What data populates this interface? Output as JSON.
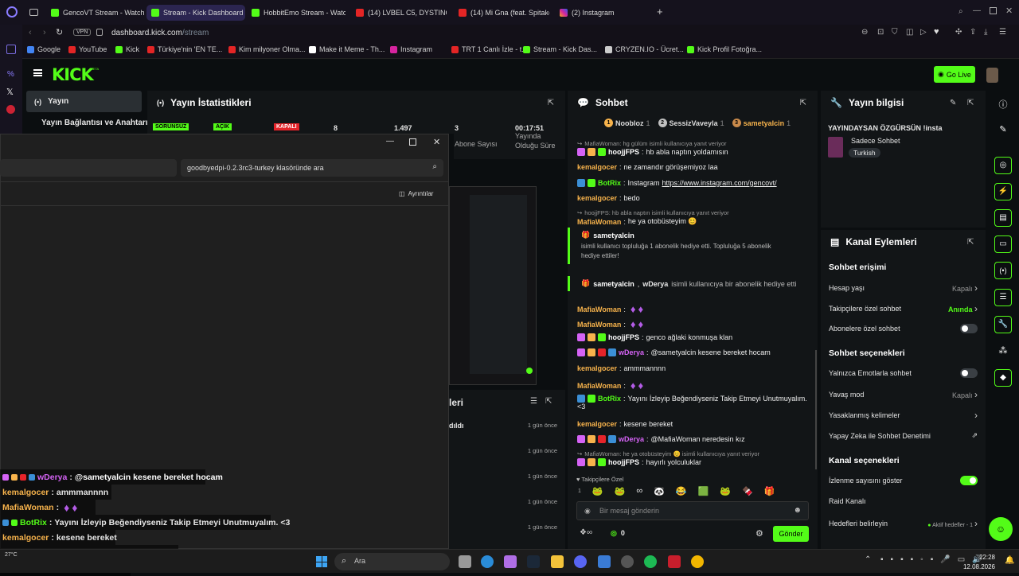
{
  "browser": {
    "tabs": [
      {
        "label": "GencoVT Stream - Watch L",
        "fav": "k"
      },
      {
        "label": "Stream - Kick Dashboard",
        "fav": "k",
        "active": true
      },
      {
        "label": "HobbitEmo Stream - Watc",
        "fav": "k"
      },
      {
        "label": "(14) LVBEL C5, DYSTINCT",
        "fav": "y"
      },
      {
        "label": "(14) Mi Gna (feat. Spitakci",
        "fav": "y"
      },
      {
        "label": "(2) Instagram",
        "fav": "i"
      }
    ],
    "new_tab": "+",
    "vpn": "VPN",
    "url_domain": "dashboard.kick.com",
    "url_path": "/stream",
    "bookmarks": [
      "Google",
      "YouTube",
      "Kick",
      "Türkiye'nin 'EN TE...",
      "Kim milyoner Olma...",
      "Make it Meme - Th...",
      "Instagram",
      "TRT 1 Canlı İzle - t...",
      "Stream - Kick Das...",
      "CRYZEN.IO - Ücret...",
      "Kick Profil Fotoğra..."
    ]
  },
  "kick": {
    "logo": "KICK",
    "beta": "BETA",
    "go_live": "Go Live",
    "nav": {
      "stream": "Yayın",
      "connection": "Yayın Bağlantısı ve Anahtarı"
    },
    "stats": {
      "title": "Yayın İstatistikleri",
      "badges": [
        "SORUNSUZ",
        "AÇIK",
        "KAPALI"
      ],
      "viewers": "8",
      "followers": "1.497",
      "subs": "3",
      "subs_label": "Abone Sayısı",
      "duration": "00:17:51",
      "duration_label": "Yayında Olduğu Süre"
    },
    "chat": {
      "title": "Sohbet",
      "top": [
        {
          "rank": "1",
          "name": "Noobloz",
          "n": "1"
        },
        {
          "rank": "2",
          "name": "SessizVaveyla",
          "n": "1"
        },
        {
          "rank": "3",
          "name": "sametyalcin",
          "n": "1"
        }
      ],
      "messages": [
        {
          "reply": "MafiaWoman: hg gülüm isimli kullanıcıya yanıt veriyor",
          "user": "hoojjFPS",
          "color": "#ffffff",
          "text": "hb abla naptın yoldamısın"
        },
        {
          "user": "kemalgocer",
          "color": "#f7b34c",
          "text": "ne zamandır görüşemiyoz laa"
        },
        {
          "user": "BotRix",
          "color": "#53fc18",
          "text": "Instagram ",
          "link": "https://www.instagram.com/gencovt/"
        },
        {
          "user": "kemalgocer",
          "color": "#f7b34c",
          "text": "bedo"
        },
        {
          "reply": "hoojjFPS: hb abla naptın isimli kullanıcıya yanıt veriyor",
          "user": "MafiaWoman",
          "color": "#f7b34c",
          "text": "he ya otobüsteyim 😊"
        }
      ],
      "gift1": {
        "user": "sametyalcin",
        "text": "isimli kullanıcı topluluğa 1 abonelik hediye etti. Topluluğa 5 abonelik hediye ettiler!"
      },
      "gift2": {
        "user": "sametyalcin",
        "user2": "wDerya",
        "text": "isimli kullanıcıya bir abonelik hediye etti"
      },
      "messages2": [
        {
          "user": "MafiaWoman",
          "color": "#f7b34c",
          "text": ""
        },
        {
          "user": "MafiaWoman",
          "color": "#f7b34c",
          "text": ""
        },
        {
          "user": "hoojjFPS",
          "color": "#ffffff",
          "text": "genco ağlaki konmuşa klan"
        },
        {
          "user": "wDerya",
          "color": "#d563f5",
          "text": "@sametyalcin kesene bereket hocam"
        },
        {
          "user": "kemalgocer",
          "color": "#f7b34c",
          "text": "ammmannnn"
        },
        {
          "user": "MafiaWoman",
          "color": "#f7b34c",
          "text": ""
        },
        {
          "user": "BotRix",
          "color": "#53fc18",
          "text": "Yayını İzleyip Beğendiyseniz Takip Etmeyi Unutmuyalım."
        },
        {
          "user": "",
          "color": "#eee",
          "text": "<3"
        },
        {
          "user": "kemalgocer",
          "color": "#f7b34c",
          "text": "kesene bereket"
        },
        {
          "user": "wDerya",
          "color": "#d563f5",
          "text": "@MafiaWoman neredesin kız"
        },
        {
          "reply": "MafiaWoman: he ya otobüsteyim 😊 isimli kullanıcıya yanıt veriyor",
          "user": "hoojjFPS",
          "color": "#ffffff",
          "text": "hayırlı yolculuklar"
        }
      ],
      "followers_only": "Takipçilere Özel",
      "emote_count": "1",
      "placeholder": "Bir mesaj gönderin",
      "kicks": "0",
      "send": "Gönder"
    },
    "stream_info": {
      "title": "Yayın bilgisi",
      "stream_title": "YAYINDAYSAN ÖZGÜRSÜN !insta",
      "category": "Sadece Sohbet",
      "tag": "Turkish"
    },
    "actions": {
      "title": "Kanal Eylemleri",
      "chat_access": "Sohbet erişimi",
      "account_age": "Hesap yaşı",
      "account_age_val": "Kapalı",
      "followers_chat": "Takipçilere özel sohbet",
      "followers_chat_val": "Anında",
      "subs_chat": "Abonelere özel sohbet",
      "chat_options": "Sohbet seçenekleri",
      "emotes_only": "Yalnızca Emotlarla sohbet",
      "slow": "Yavaş mod",
      "slow_val": "Kapalı",
      "banned_words": "Yasaklanmış kelimeler",
      "ai_mod": "Yapay Zeka ile Sohbet Denetimi",
      "channel_options": "Kanal seçenekleri",
      "show_viewers": "İzlenme sayısını göster",
      "raid": "Raid Kanalı",
      "goals": "Hedefleri belirleyin",
      "goals_val": "Aktif hedefler - 1"
    },
    "recent": {
      "title": "leri",
      "item": "dıldı",
      "times": [
        "1 gün önce",
        "1 gün önce",
        "1 gün önce",
        "1 gün önce",
        "1 gün önce"
      ]
    }
  },
  "explorer": {
    "search": "goodbyedpi-0.2.3rc3-turkey klasöründe ara",
    "details": "Ayrıntılar"
  },
  "overlay": [
    {
      "user": "wDerya",
      "color": "#d563f5",
      "text": "@sametyalcin kesene bereket hocam",
      "mention": true
    },
    {
      "user": "kemalgocer",
      "color": "#f7b34c",
      "text": "ammmannnn"
    },
    {
      "user": "MafiaWoman",
      "color": "#f7b34c",
      "text": ""
    },
    {
      "user": "BotRix",
      "color": "#53fc18",
      "text": "Yayını İzleyip Beğendiyseniz Takip Etmeyi Unutmuyalım. <3"
    },
    {
      "user": "kemalgocer",
      "color": "#f7b34c",
      "text": "kesene bereket"
    },
    {
      "user": "wDerya",
      "color": "#d563f5",
      "text": "@MafiaWoman neredesin kız",
      "mention": true
    },
    {
      "user": "hoojjFPS",
      "color": "#ffffff",
      "text": "hayırlı yolculuklar"
    }
  ],
  "taskbar": {
    "search": "Ara",
    "weather": "27°C",
    "time": "22:28",
    "date": "12.08.2026"
  }
}
